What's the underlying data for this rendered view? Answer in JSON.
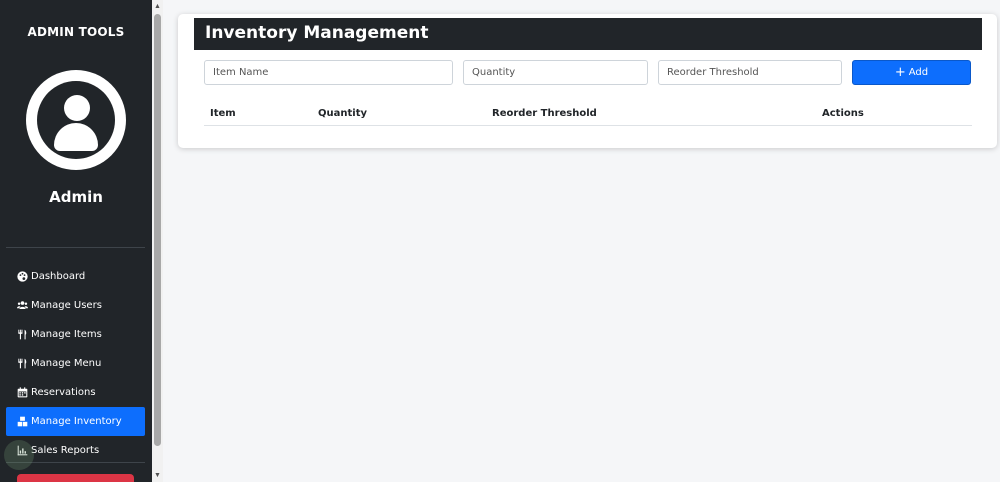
{
  "sidebar": {
    "brand": "ADMIN TOOLS",
    "user_name": "Admin",
    "items": [
      {
        "label": "Dashboard",
        "icon": "palette-icon"
      },
      {
        "label": "Manage Users",
        "icon": "users-icon"
      },
      {
        "label": "Manage Items",
        "icon": "utensils-icon"
      },
      {
        "label": "Manage Menu",
        "icon": "utensils-icon"
      },
      {
        "label": "Reservations",
        "icon": "calendar-icon"
      },
      {
        "label": "Manage Inventory",
        "icon": "boxes-icon",
        "active": true
      },
      {
        "label": "Sales Reports",
        "icon": "chart-icon"
      }
    ]
  },
  "inventory": {
    "title": "Inventory Management",
    "inputs": {
      "item_name_placeholder": "Item Name",
      "quantity_placeholder": "Quantity",
      "threshold_placeholder": "Reorder Threshold"
    },
    "add_button": {
      "icon": "+",
      "label": "Add"
    },
    "table": {
      "columns": [
        "Item",
        "Quantity",
        "Reorder Threshold",
        "Actions"
      ]
    }
  },
  "colors": {
    "sidebar_bg": "#212529",
    "active_item": "#0d6efd",
    "primary_button": "#0d6efd",
    "danger_button": "#dc3545",
    "page_bg": "#f5f6f8"
  }
}
